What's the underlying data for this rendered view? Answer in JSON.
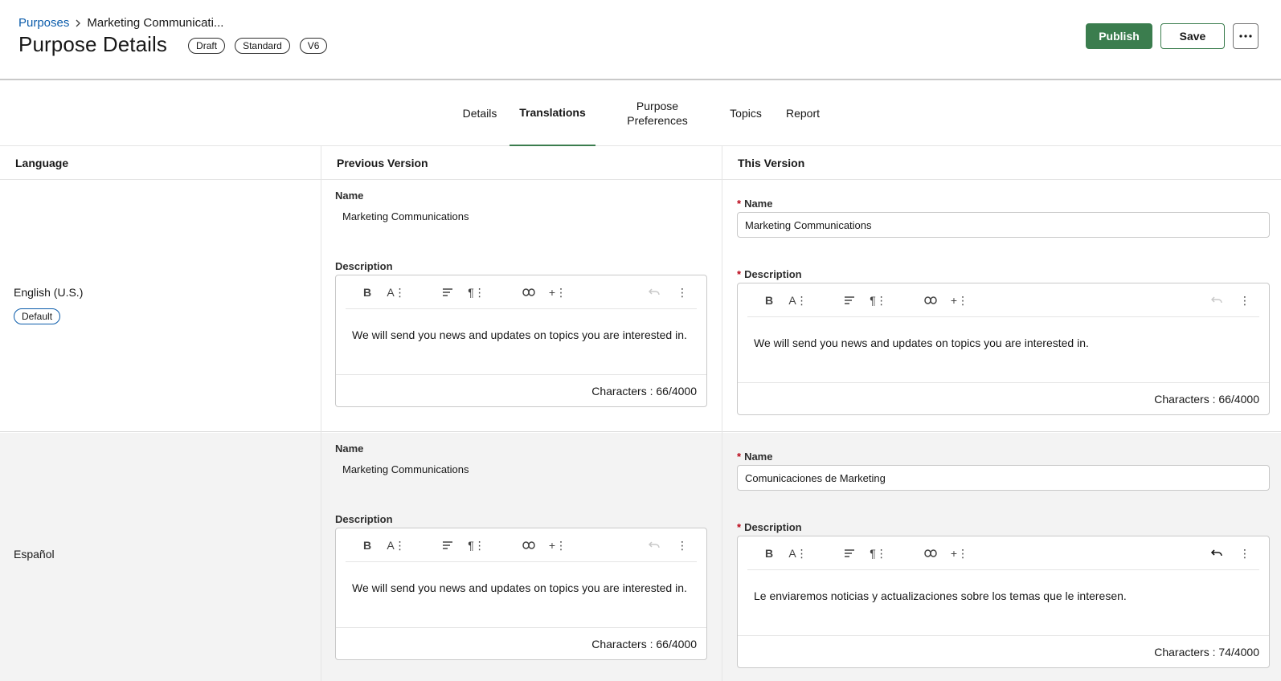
{
  "breadcrumb": {
    "parent": "Purposes",
    "current": "Marketing Communicati..."
  },
  "page": {
    "title": "Purpose Details",
    "badges": [
      "Draft",
      "Standard",
      "V6"
    ]
  },
  "actions": {
    "publish": "Publish",
    "save": "Save",
    "more": "···"
  },
  "tabs": [
    {
      "label": "Details"
    },
    {
      "label": "Translations"
    },
    {
      "label": "Purpose Preferences"
    },
    {
      "label": "Topics"
    },
    {
      "label": "Report"
    }
  ],
  "table": {
    "headers": {
      "language": "Language",
      "previous": "Previous Version",
      "current": "This Version"
    },
    "name_label": "Name",
    "description_label": "Description",
    "required_marker": "*",
    "rows": [
      {
        "language": "English (U.S.)",
        "default_badge": "Default",
        "previous": {
          "name": "Marketing Communications",
          "description": "We will send you news and updates on topics you are interested in.",
          "char_count": "Characters : 66/4000"
        },
        "current": {
          "name": "Marketing Communications",
          "description": "We will send you news and updates on topics you are interested in.",
          "char_count": "Characters : 66/4000"
        }
      },
      {
        "language": "Español",
        "previous": {
          "name": "Marketing Communications",
          "description": "We will send you news and updates on topics you are interested in.",
          "char_count": "Characters : 66/4000"
        },
        "current": {
          "name": "Comunicaciones de Marketing",
          "description": "Le enviaremos noticias y actualizaciones sobre los temas que le interesen.",
          "char_count": "Characters : 74/4000"
        }
      }
    ]
  },
  "toolbar_icons": [
    "bold-icon",
    "font-size-icon",
    "align-icon",
    "paragraph-icon",
    "link-icon",
    "insert-icon",
    "undo-icon",
    "more-vertical-icon"
  ],
  "colors": {
    "primary": "#3b7d4e",
    "link": "#0b5cab",
    "required": "#ba0517"
  }
}
